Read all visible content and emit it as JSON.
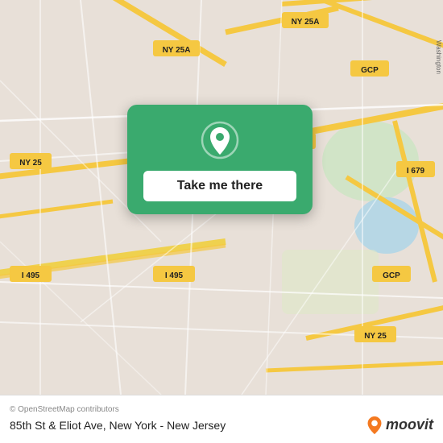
{
  "map": {
    "background_color": "#e8e0d8",
    "road_color_yellow": "#f5c842",
    "road_color_white": "#ffffff",
    "green_area": "#c8e6c0",
    "water_color": "#aad4e8"
  },
  "card": {
    "background": "#3aaa6e",
    "button_label": "Take me there",
    "pin_icon": "location-pin"
  },
  "footer": {
    "copyright": "© OpenStreetMap contributors",
    "location_name": "85th St & Eliot Ave, New York - New Jersey",
    "moovit_label": "moovit"
  }
}
